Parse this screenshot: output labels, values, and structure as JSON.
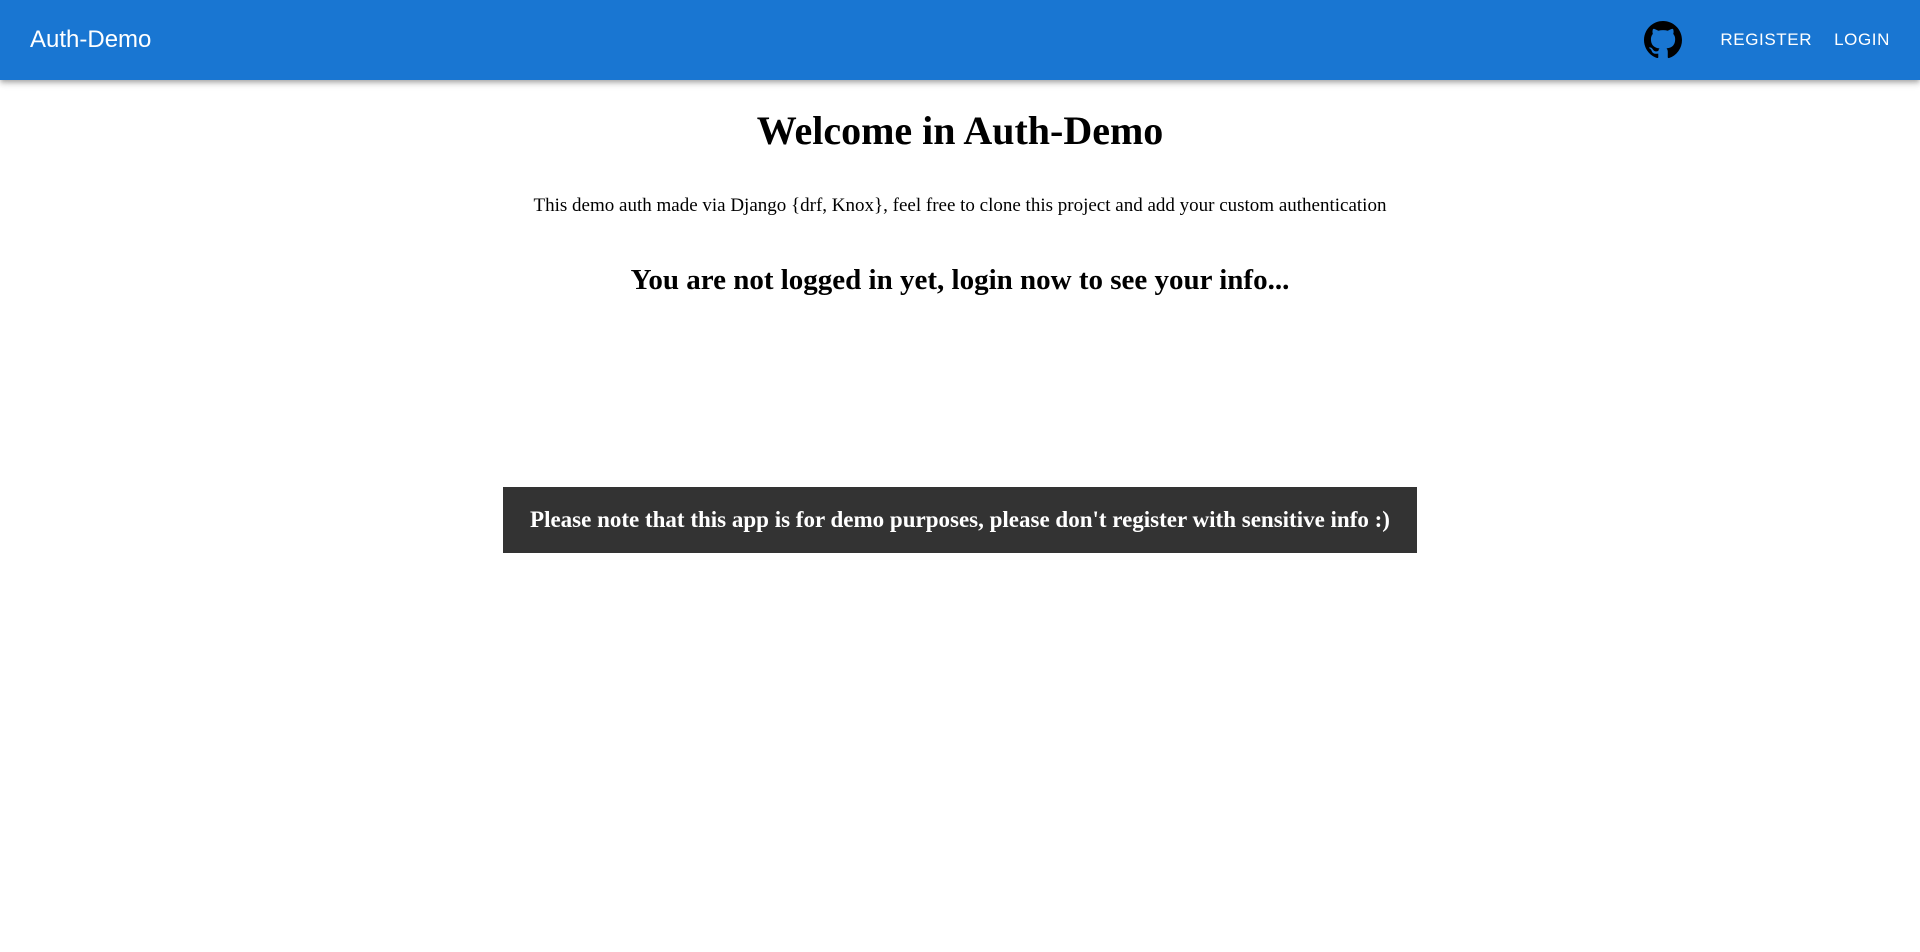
{
  "header": {
    "brand": "Auth-Demo",
    "github_icon": "github-icon",
    "register_label": "Register",
    "login_label": "Login",
    "background_color": "#1976d2"
  },
  "main": {
    "title": "Welcome in Auth-Demo",
    "intro": "This demo auth made via Django {drf, Knox}, feel free to clone this project and add your custom authentication",
    "status": "You are not logged in yet, login now to see your info..."
  },
  "notice": {
    "text": "Please note that this app is for demo purposes, please don't register with sensitive info :)",
    "background_color": "#333333"
  }
}
